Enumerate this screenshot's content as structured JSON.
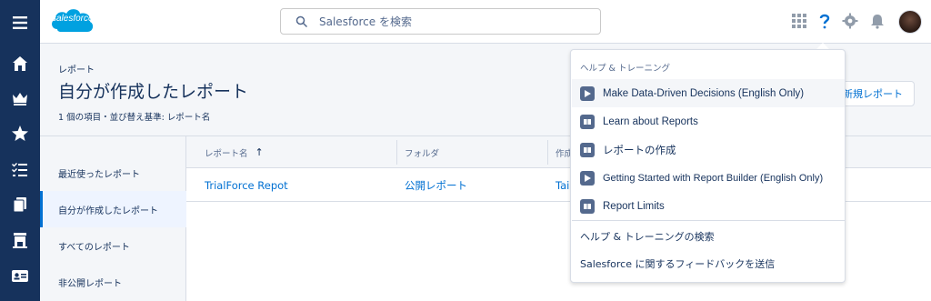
{
  "header": {
    "logo_text": "salesforce",
    "search_placeholder": "Salesforce を検索"
  },
  "page": {
    "kicker": "レポート",
    "title": "自分が作成したレポート",
    "meta": "1 個の項目・並び替え基準: レポート名",
    "new_button": "新規レポート"
  },
  "leftnav": {
    "items": [
      {
        "label": "最近使ったレポート"
      },
      {
        "label": "自分が作成したレポート"
      },
      {
        "label": "すべてのレポート"
      },
      {
        "label": "非公開レポート"
      }
    ]
  },
  "table": {
    "columns": [
      "レポート名",
      "フォルダ",
      "作成"
    ],
    "sort_indicator": "↑",
    "rows": [
      {
        "name": "TrialForce Repot",
        "folder": "公開レポート",
        "creator": "Tai"
      }
    ]
  },
  "help_menu": {
    "title": "ヘルプ & トレーニング",
    "items": [
      {
        "label": "Make Data-Driven Decisions (English Only)",
        "icon": "video-icon"
      },
      {
        "label": "Learn about Reports",
        "icon": "book-icon"
      },
      {
        "label": "レポートの作成",
        "icon": "book-icon"
      },
      {
        "label": "Getting Started with Report Builder (English Only)",
        "icon": "video-icon"
      },
      {
        "label": "Report Limits",
        "icon": "book-icon"
      }
    ],
    "links": [
      "ヘルプ & トレーニングの検索",
      "Salesforce に関するフィードバックを送信"
    ]
  },
  "colors": {
    "rail": "#16325c",
    "accent": "#0070d2",
    "overlay": "#b0c4df"
  }
}
